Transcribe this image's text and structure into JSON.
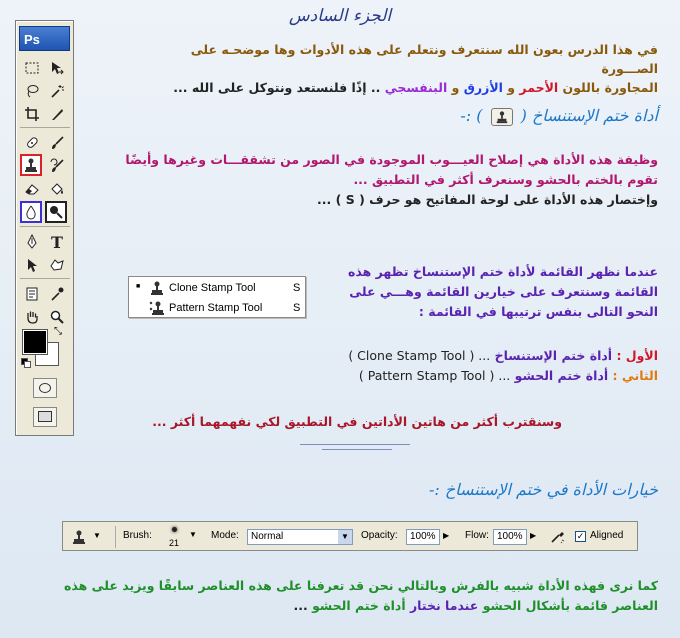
{
  "title": "الجزء السادس",
  "intro": {
    "line1": "في هذا الدرس بعون الله سنتعرف ونتعلم على هذه الأدوات وها موضحـه على الصـــورة",
    "line2_part1": "المجاورة باللون",
    "red_word": "الأحمر",
    "and1": "و",
    "blue_word": "الأزرق",
    "and2": "و",
    "purple_word": "البنفسجي",
    "line2_part2": ".. إذًا فلنستعد ونتوكل على الله ..."
  },
  "clone_heading": {
    "prefix": "أداة ختم الإستنساخ (",
    "suffix": ") :-"
  },
  "clone_desc": {
    "line1": "وظيفة هذه الأداة هي إصلاح العيـــوب الموجودة في الصور من تشققـــات وغيرها وأيضًا",
    "line2": "تقوم بالختم بالحشو وسنعرف أكثر في التطبيق ...",
    "line3": "وإختصار هذه الأداة على لوحة المفاتيح هو حرف ( S ) ..."
  },
  "menu_info": {
    "line1": "عندما نظهر القائمة لأداة ختم الإستنساخ تظهر هذه",
    "line2": "القائمة وسنتعرف على خيارين القائمة وهـــي على",
    "line3": "النحو التالى بنفس ترتيبها في القائمة :"
  },
  "flyout": {
    "items": [
      {
        "label": "Clone Stamp Tool",
        "key": "S",
        "active": true
      },
      {
        "label": "Pattern Stamp Tool",
        "key": "S",
        "active": false
      }
    ]
  },
  "order": {
    "first_label": "الأول :",
    "first_text": "أداة ختم الإستنساخ",
    "first_en": "( Clone Stamp Tool ) ...",
    "second_label": "الثاني :",
    "second_text": "أداة ختم الحشو",
    "second_en": "( Pattern Stamp Tool ) ..."
  },
  "closing": "وسنقترب أكثر من هاتين الأداتين في التطبيق لكي نفهمهما أكثر ...",
  "options_heading": "خيارات الأداة في ختم الإستنساخ :-",
  "options_bar": {
    "brush_label": "Brush:",
    "brush_size": "21",
    "mode_label": "Mode:",
    "mode_value": "Normal",
    "opacity_label": "Opacity:",
    "opacity_value": "100%",
    "flow_label": "Flow:",
    "flow_value": "100%",
    "aligned_label": "Aligned",
    "aligned_checked": true
  },
  "final": {
    "line1": "كما نرى فهذه الأداة شبيه بالفرش وبالتالي نحن قد تعرفنا على هذه العناصر سابقًا ويزيد على هذه",
    "line2_part1": "العناصر قائمة بأشكال الحشو",
    "line2_part2": "عندما نختار",
    "line2_part3": "أداة ختم الحشو",
    "line2_part4": "..."
  },
  "toolbox": {
    "logo": "Ps",
    "text_tool": "T"
  },
  "colors": {
    "accent_blue": "#1a78c8",
    "highlight_red": "#d8222c",
    "highlight_blue": "#3a2fd8"
  }
}
